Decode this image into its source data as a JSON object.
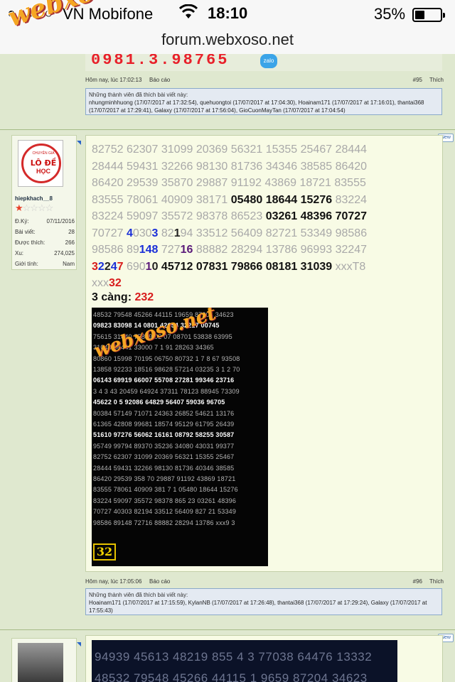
{
  "status_bar": {
    "signal": "●●●○○",
    "carrier": "VN Mobifone",
    "time": "18:10",
    "battery_percent": "35%",
    "battery_level": 0.35
  },
  "url_bar": {
    "domain": "forum.webxoso.net"
  },
  "watermark": "webxoso.net",
  "top_post": {
    "phone_number": "0981.3.98765",
    "zalo_label": "zalo",
    "meta": {
      "date": "Hôm nay, lúc 17:02:13",
      "report": "Báo cáo",
      "number": "#95",
      "like": "Thích"
    },
    "likes": {
      "title": "Những thành viên đã thích bài viết này:",
      "line1": "nhungminhhuong (17/07/2017 at 17:32:54), quehuongtoi (17/07/2017 at 17:04:30), Hoainam171 (17/07/2017 at 17:16:01), thantai368",
      "line2": "(17/07/2017 at 17:29:41), Galaxy (17/07/2017 at 17:56:04), GioCuonMayTan (17/07/2017 at 17:04:54)"
    }
  },
  "new_label": "New",
  "user": {
    "avatar_top": "CHUYÊN GIA",
    "avatar_mid": "LÔ ĐỀ",
    "avatar_bot": "HỌC",
    "username": "hiepkhach__8",
    "rating": 1,
    "stats": [
      {
        "label": "Đ.Ký:",
        "value": "07/11/2016"
      },
      {
        "label": "Bài viết:",
        "value": "28"
      },
      {
        "label": "Được thích:",
        "value": "266"
      },
      {
        "label": "Xu:",
        "value": "274,025"
      },
      {
        "label": "Giới tính:",
        "value": "Nam"
      }
    ]
  },
  "post": {
    "line1": "82752 62307 31099 20369 56321 15355 25467 28444",
    "line2": "28444 59431 32266 98130 81736 34346 38585 86420",
    "line3": "86420 29539 35870 29887 91192 43869 18721 83555",
    "line4a": "83555 78061 40909 38171 ",
    "line4b": "05480 18644 15276",
    "line4c": " 83224",
    "line5a": "83224 59097 35572 98378 86523 ",
    "line5b": "03261 48396 70727",
    "line6a": "70727 ",
    "line6b": "4",
    "line6c": "030",
    "line6d": "3",
    "line6e": " 82",
    "line6f": "1",
    "line6g": "94 33512 56409 82721 53349 98586",
    "line7a": "98586 89",
    "line7b": "148",
    "line7c": " 727",
    "line7d": "16",
    "line7e": " 88882 28294 13786 96993 32247",
    "line8a": "3",
    "line8b": "2",
    "line8c": "2",
    "line8d": "4",
    "line8e": "7",
    "line8f": " 690",
    "line8g": "1",
    "line8h": "0",
    "line8i": " 45712 07831 79866 08181 31039",
    "line8j": " xxxT8",
    "line9a": "xxx",
    "line9b": "32",
    "cang_label": "3 càng: ",
    "cang_value": "232",
    "image_rows": [
      "48532 79548 45266 44115 19659 87204 34623",
      "09823 83098 14    0801 42654 32217 00745",
      "75615 31640 75849 02 07 08701 53838 63995",
      "         31040 98441 33000 7 1 91 28263 34365",
      "80860 15998 70195 06750 80732 1 7 8 67 93508",
      "13858 92233 18516 98628 57214 03235 3 1 2 70",
      "06143 69919 66007 55708 27281 99346 23716",
      "3 4 3 43 20459 64924 37311 78123 88945 73309",
      "45622 0     5 92086 64829 56407 59036 96705",
      "80384 57149 71071 24363 26852 54621 13176",
      "61365 42808 99681 18574 95129 61795 26439",
      "51610 97276 56062 16161 08792 58255 30587",
      "95749 99794 89370 35236 34080 43031 99377",
      "82752 62307 31099 20369 56321 15355 25467",
      "28444 59431 32266 98130 81736 40346 38585",
      "86420 29539 358 70 29887 91192 43869 18721",
      "83555 78061 40909 381 7 1 05480 18644 15276",
      "83224 59097 35572 98378 865 23 03261 48396",
      "70727 40303 82194 33512 56409 827 21 53349",
      "98586 89148 72716 88882 28294 13786 xxx9 3"
    ],
    "image_badge": "32",
    "meta": {
      "date": "Hôm nay, lúc 17:05:06",
      "report": "Báo cáo",
      "number": "#96",
      "like": "Thích"
    },
    "likes": {
      "title": "Những thành viên đã thích bài viết này:",
      "line1": "Hoainam171 (17/07/2017 at 17:15:59), KylanNB (17/07/2017 at 17:26:48), thantai368 (17/07/2017 at 17:29:24), Galaxy (17/07/2017 at",
      "line2": "17:55:43)"
    }
  },
  "next_post": {
    "rows": [
      "94939 45613 48219 855 4 3 77038 64476 13332",
      "48532 79548 45266 44115 1 9659 87204 34623"
    ]
  }
}
